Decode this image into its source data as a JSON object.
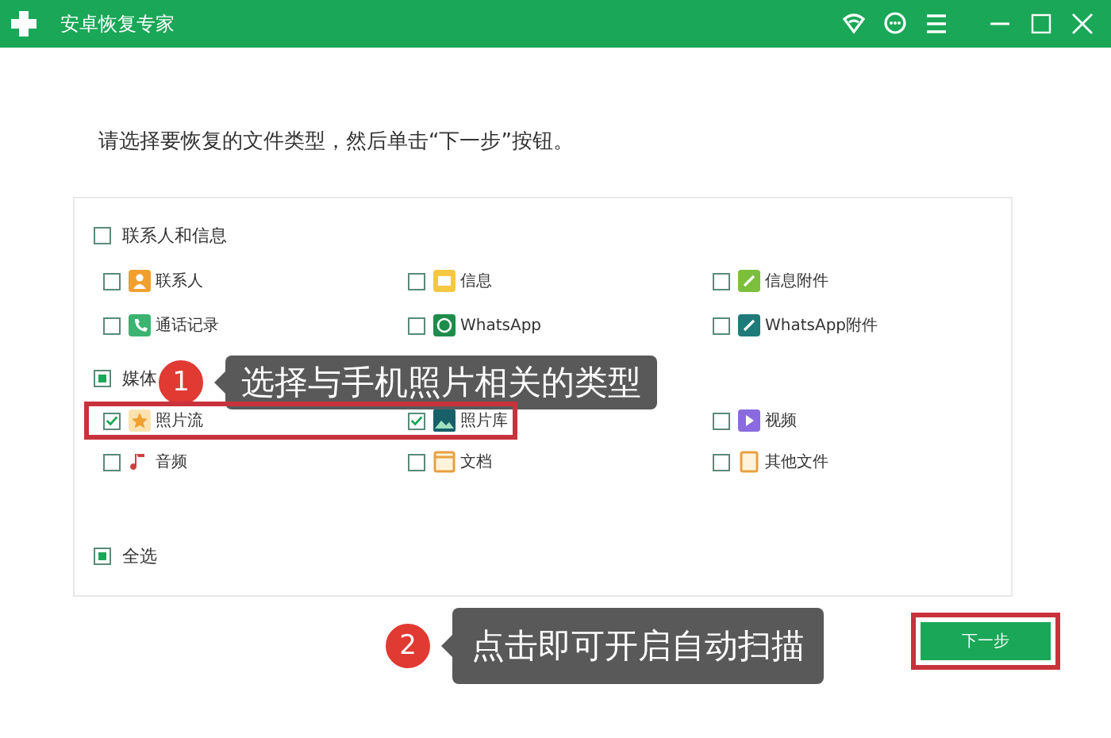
{
  "window": {
    "title": "安卓恢复专家"
  },
  "instruction": "请选择要恢复的文件类型，然后单击“下一步”按钮。",
  "groups": [
    {
      "label": "联系人和信息",
      "checked": false,
      "partial": false,
      "items": [
        {
          "label": "联系人",
          "checked": false,
          "highlighted": false
        },
        {
          "label": "信息",
          "checked": false,
          "highlighted": false
        },
        {
          "label": "信息附件",
          "checked": false,
          "highlighted": false
        },
        {
          "label": "通话记录",
          "checked": false,
          "highlighted": false
        },
        {
          "label": "WhatsApp",
          "checked": false,
          "highlighted": false
        },
        {
          "label": "WhatsApp附件",
          "checked": false,
          "highlighted": false
        }
      ]
    },
    {
      "label": "媒体",
      "checked": false,
      "partial": true,
      "items": [
        {
          "label": "照片流",
          "checked": true,
          "highlighted": true
        },
        {
          "label": "照片库",
          "checked": true,
          "highlighted": true
        },
        {
          "label": "视频",
          "checked": false,
          "highlighted": false
        },
        {
          "label": "音频",
          "checked": false,
          "highlighted": false
        },
        {
          "label": "文档",
          "checked": false,
          "highlighted": false
        },
        {
          "label": "其他文件",
          "checked": false,
          "highlighted": false
        }
      ]
    }
  ],
  "select_all": {
    "label": "全选",
    "checked": false,
    "partial": true
  },
  "next_button": {
    "label": "下一步",
    "highlighted": true
  },
  "callouts": [
    {
      "number": "1",
      "text": "选择与手机照片相关的类型"
    },
    {
      "number": "2",
      "text": "点击即可开启自动扫描"
    }
  ]
}
